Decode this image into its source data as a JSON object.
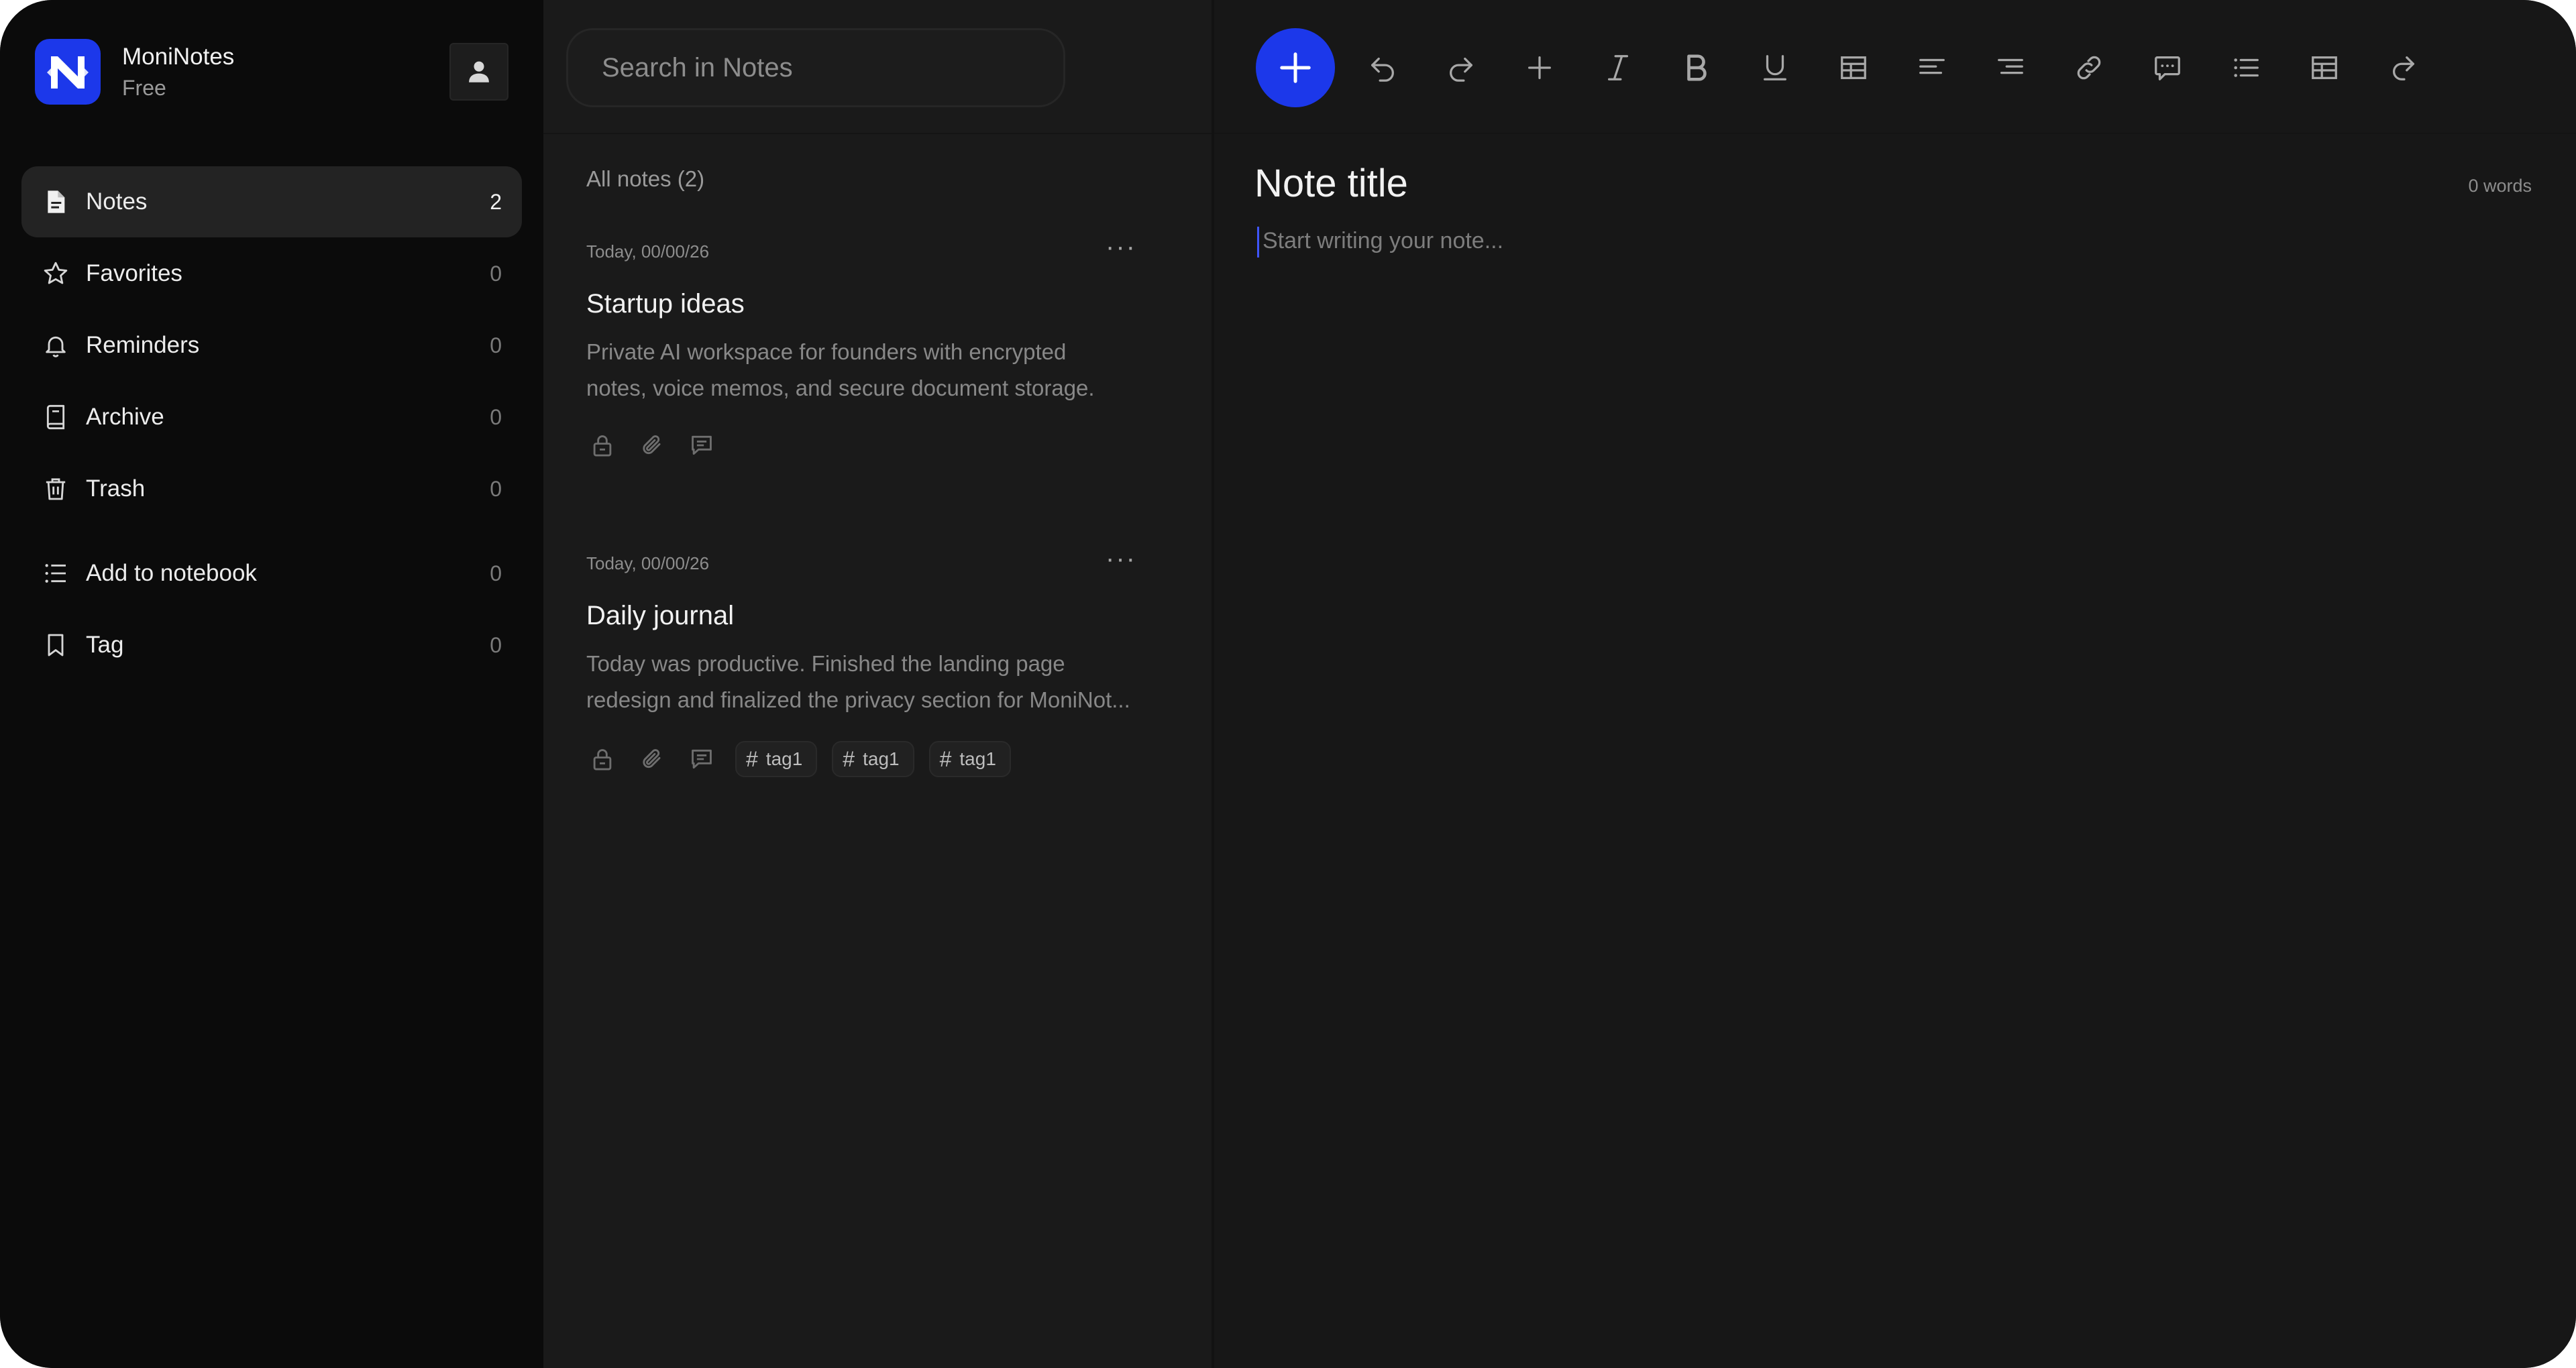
{
  "brand": {
    "name": "MoniNotes",
    "plan": "Free"
  },
  "sidebar": {
    "items": [
      {
        "label": "Notes",
        "count": "2"
      },
      {
        "label": "Favorites",
        "count": "0"
      },
      {
        "label": "Reminders",
        "count": "0"
      },
      {
        "label": "Archive",
        "count": "0"
      },
      {
        "label": "Trash",
        "count": "0"
      },
      {
        "label": "Add to notebook",
        "count": "0"
      },
      {
        "label": "Tag",
        "count": "0"
      }
    ]
  },
  "search": {
    "placeholder": "Search in Notes"
  },
  "notes_list": {
    "header": "All notes (2)",
    "more_label": "···",
    "notes": [
      {
        "date": "Today, 00/00/26",
        "title": "Startup ideas",
        "body_line1": "Private AI workspace for founders with encrypted",
        "body_line2": "notes, voice memos, and secure document storage.",
        "tags": []
      },
      {
        "date": "Today, 00/00/26",
        "title": "Daily journal",
        "body_line1": "Today was productive. Finished the landing page",
        "body_line2": "redesign and finalized the privacy section for MoniNot...",
        "tags": [
          "tag1",
          "tag1",
          "tag1"
        ]
      }
    ]
  },
  "editor": {
    "title": "Note title",
    "word_count": "0 words",
    "placeholder": "Start writing your note..."
  },
  "toolbar": {
    "icons": [
      "undo-icon",
      "redo-icon",
      "plus-icon",
      "italic-icon",
      "bold-icon",
      "underline-icon",
      "table-icon",
      "align-left-icon",
      "align-right-icon",
      "link-icon",
      "comment-icon",
      "bulleted-list-icon",
      "table-icon",
      "forward-icon"
    ]
  },
  "colors": {
    "accent": "#1c38ea",
    "sidebar_bg": "#0b0b0b",
    "list_bg": "#1a1a1a",
    "editor_bg": "#171717"
  }
}
